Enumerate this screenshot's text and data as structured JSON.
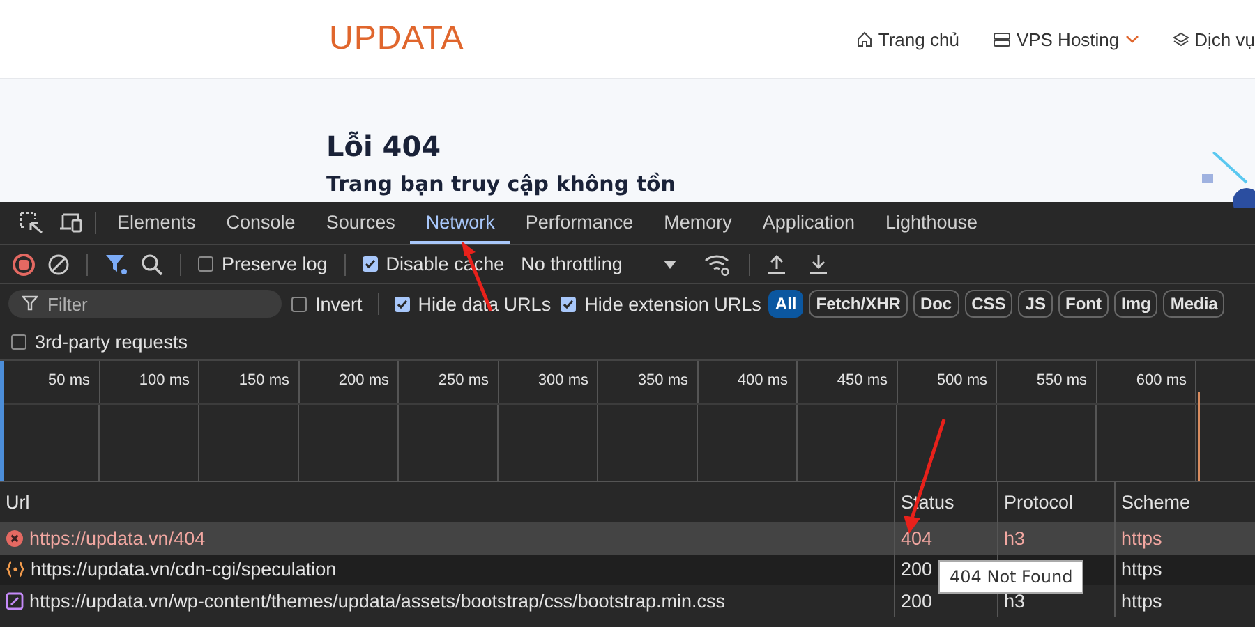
{
  "site": {
    "logo": "UPDATA",
    "nav": [
      {
        "kind": "home",
        "label": "Trang chủ",
        "dropdown": false
      },
      {
        "kind": "server",
        "label": "VPS Hosting",
        "dropdown": true
      },
      {
        "kind": "layers",
        "label": "Dịch vụ",
        "dropdown": false
      }
    ],
    "error_title": "Lỗi 404",
    "heading": "Trang bạn truy cập không tồn"
  },
  "devtools": {
    "tabs": [
      {
        "label": "Elements",
        "selected": false
      },
      {
        "label": "Console",
        "selected": false
      },
      {
        "label": "Sources",
        "selected": false
      },
      {
        "label": "Network",
        "selected": true
      },
      {
        "label": "Performance",
        "selected": false
      },
      {
        "label": "Memory",
        "selected": false
      },
      {
        "label": "Application",
        "selected": false
      },
      {
        "label": "Lighthouse",
        "selected": false
      }
    ],
    "toolbar": {
      "preserve_log": {
        "label": "Preserve log",
        "checked": false
      },
      "disable_cache": {
        "label": "Disable cache",
        "checked": true
      },
      "throttling": "No throttling"
    },
    "filter": {
      "placeholder": "Filter",
      "options": [
        {
          "label": "Invert",
          "checked": false
        },
        {
          "label": "Hide data URLs",
          "checked": true
        },
        {
          "label": "Hide extension URLs",
          "checked": true
        }
      ],
      "types": [
        {
          "label": "All",
          "selected": true
        },
        {
          "label": "Fetch/XHR",
          "selected": false
        },
        {
          "label": "Doc",
          "selected": false
        },
        {
          "label": "CSS",
          "selected": false
        },
        {
          "label": "JS",
          "selected": false
        },
        {
          "label": "Font",
          "selected": false
        },
        {
          "label": "Img",
          "selected": false
        },
        {
          "label": "Media",
          "selected": false
        }
      ],
      "third_party": {
        "label": "3rd-party requests",
        "checked": false
      }
    },
    "timeline_ticks": [
      "50 ms",
      "100 ms",
      "150 ms",
      "200 ms",
      "250 ms",
      "300 ms",
      "350 ms",
      "400 ms",
      "450 ms",
      "500 ms",
      "550 ms",
      "600 ms"
    ],
    "table": {
      "columns": [
        "Url",
        "Status",
        "Protocol",
        "Scheme"
      ],
      "rows": [
        {
          "kind": "error",
          "url": "https://updata.vn/404",
          "status": "404",
          "protocol": "h3",
          "scheme": "https",
          "selected": true,
          "failed": true
        },
        {
          "kind": "script",
          "url": "https://updata.vn/cdn-cgi/speculation",
          "status": "200",
          "scheme": "https",
          "selected": false,
          "failed": false
        },
        {
          "kind": "stylesheet",
          "url": "https://updata.vn/wp-content/themes/updata/assets/bootstrap/css/bootstrap.min.css",
          "status": "200",
          "protocol": "h3",
          "scheme": "https",
          "selected": false,
          "failed": false
        }
      ]
    },
    "tooltip": "404 Not Found"
  }
}
